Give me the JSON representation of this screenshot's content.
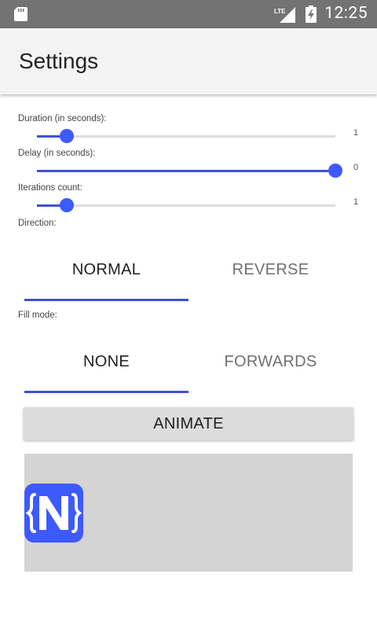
{
  "status_bar": {
    "time": "12:25",
    "network": "LTE",
    "icons": [
      "sd-card-icon",
      "lte-signal-icon",
      "battery-charging-icon"
    ]
  },
  "app_bar": {
    "title": "Settings"
  },
  "settings": {
    "duration": {
      "label": "Duration (in seconds):",
      "value": "1",
      "fraction": 0.1
    },
    "delay": {
      "label": "Delay (in seconds):",
      "value": "0",
      "fraction": 1.0
    },
    "iterations": {
      "label": "Iterations count:",
      "value": "1",
      "fraction": 0.1
    },
    "direction": {
      "label": "Direction:",
      "options": [
        "NORMAL",
        "REVERSE"
      ],
      "selected": "NORMAL"
    },
    "fill_mode": {
      "label": "Fill mode:",
      "options": [
        "NONE",
        "FORWARDS"
      ],
      "selected": "NONE"
    }
  },
  "animate_button": {
    "label": "ANIMATE"
  },
  "animation_target": {
    "icon": "nativescript-logo-icon"
  },
  "colors": {
    "accent": "#3d5afe",
    "app_bar": "#f4f4f4",
    "status_bar": "#737373",
    "stage": "#d4d4d4"
  }
}
